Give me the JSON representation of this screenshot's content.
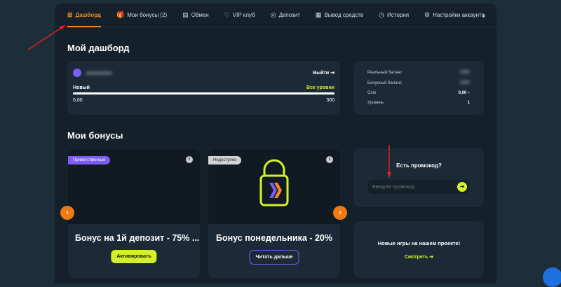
{
  "nav": {
    "items": [
      {
        "label": "Дашборд",
        "icon": "dashboard-icon",
        "glyph": "⊞",
        "active": true
      },
      {
        "label": "Мои бонусы (2)",
        "icon": "gift-icon",
        "glyph": "🎁"
      },
      {
        "label": "Обмен",
        "icon": "exchange-icon",
        "glyph": "▤"
      },
      {
        "label": "VIP клуб",
        "icon": "heart-icon",
        "glyph": "♡"
      },
      {
        "label": "Депозит",
        "icon": "deposit-icon",
        "glyph": "◎"
      },
      {
        "label": "Вывод средств",
        "icon": "withdraw-icon",
        "glyph": "▦"
      },
      {
        "label": "История",
        "icon": "history-icon",
        "glyph": "◷"
      },
      {
        "label": "Настройки аккаунта",
        "icon": "settings-icon",
        "glyph": "⚙"
      }
    ],
    "next": "›"
  },
  "dashboard": {
    "title": "Мой дашборд",
    "logout": "Выйти",
    "level_name": "Новый",
    "all_levels": "Все уровни",
    "progress_min": "0,00",
    "progress_max": "300",
    "progress": 0
  },
  "balances": {
    "rows": [
      {
        "label": "Реальный баланс",
        "value": ""
      },
      {
        "label": "Бонусный баланс",
        "value": ""
      },
      {
        "label": "Coin",
        "value": "0,00"
      },
      {
        "label": "Уровень",
        "value": "1"
      }
    ]
  },
  "bonuses": {
    "title": "Мои бонусы",
    "cards": [
      {
        "tag": "Приветственный",
        "title": "Бонус на 1й депозит - 75% ...",
        "button": "Активировать"
      },
      {
        "tag": "Недоступно",
        "title": "Бонус понедельника - 20%",
        "button": "Читать дальше"
      }
    ]
  },
  "promo": {
    "title": "Есть промокод?",
    "placeholder": "Введите промокод"
  },
  "new_games": {
    "title": "Новые игры на нашем проекте!",
    "link": "Смотреть"
  },
  "colors": {
    "accent": "#f08a24",
    "lime": "#d4f02a",
    "purple": "#7b5cf5"
  }
}
